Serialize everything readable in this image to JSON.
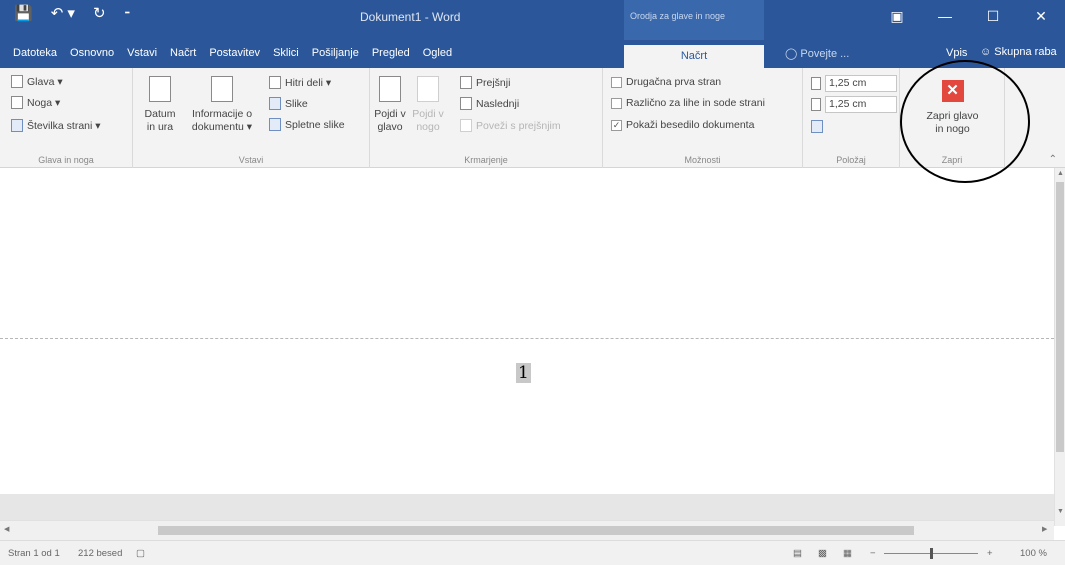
{
  "titlebar": {
    "save_icon": "save-icon",
    "undo_glyph": "↶ ▾",
    "redo_glyph": "↻",
    "customize_glyph": "⁃",
    "doc_title": "Dokument1 - Word",
    "context_title": "Orodja za glave in noge",
    "ribbon_display_glyph": "▣",
    "minimize_glyph": "—",
    "maximize_glyph": "☐",
    "close_glyph": "✕"
  },
  "tabs": [
    "Datoteka",
    "Osnovno",
    "Vstavi",
    "Načrt",
    "Postavitev",
    "Sklici",
    "Pošiljanje",
    "Pregled",
    "Ogled"
  ],
  "active_tab": "Načrt",
  "tell_me": "Povejte ...",
  "sign_in": "Vpis",
  "share": "Skupna raba",
  "ribbon": {
    "header_footer_group": {
      "label": "Glava in noga",
      "header": "Glava ▾",
      "footer": "Noga ▾",
      "page_number": "Številka strani ▾"
    },
    "insert_group": {
      "label": "Vstavi",
      "date_time": "Datum\nin ura",
      "doc_info": "Informacije o\ndokumentu ▾",
      "quick_parts": "Hitri deli ▾",
      "pictures": "Slike",
      "online_pictures": "Spletne slike"
    },
    "navigation_group": {
      "label": "Krmarjenje",
      "go_to_header": "Pojdi v\nglavo",
      "go_to_footer": "Pojdi v\nnogo",
      "previous": "Prejšnji",
      "next": "Naslednji",
      "link_previous": "Poveži s prejšnjim"
    },
    "options_group": {
      "label": "Možnosti",
      "different_first": "Drugačna prva stran",
      "different_odd_even": "Različno za lihe in sode strani",
      "show_doc_text": "Pokaži besedilo dokumenta",
      "show_doc_text_checked": true
    },
    "position_group": {
      "label": "Položaj",
      "header_from_top": "1,25 cm",
      "footer_from_bottom": "1,25 cm"
    },
    "close_group": {
      "label": "Zapri",
      "close_button": "Zapri glavo\nin nogo"
    }
  },
  "document": {
    "page_number": "1"
  },
  "statusbar": {
    "page": "Stran 1 od 1",
    "words": "212 besed",
    "zoom": "100 %",
    "zoom_minus": "−",
    "zoom_plus": "+"
  },
  "colors": {
    "titlebar": "#2b579a",
    "context_tab": "#3a68ad",
    "close_button": "#e2483d"
  }
}
